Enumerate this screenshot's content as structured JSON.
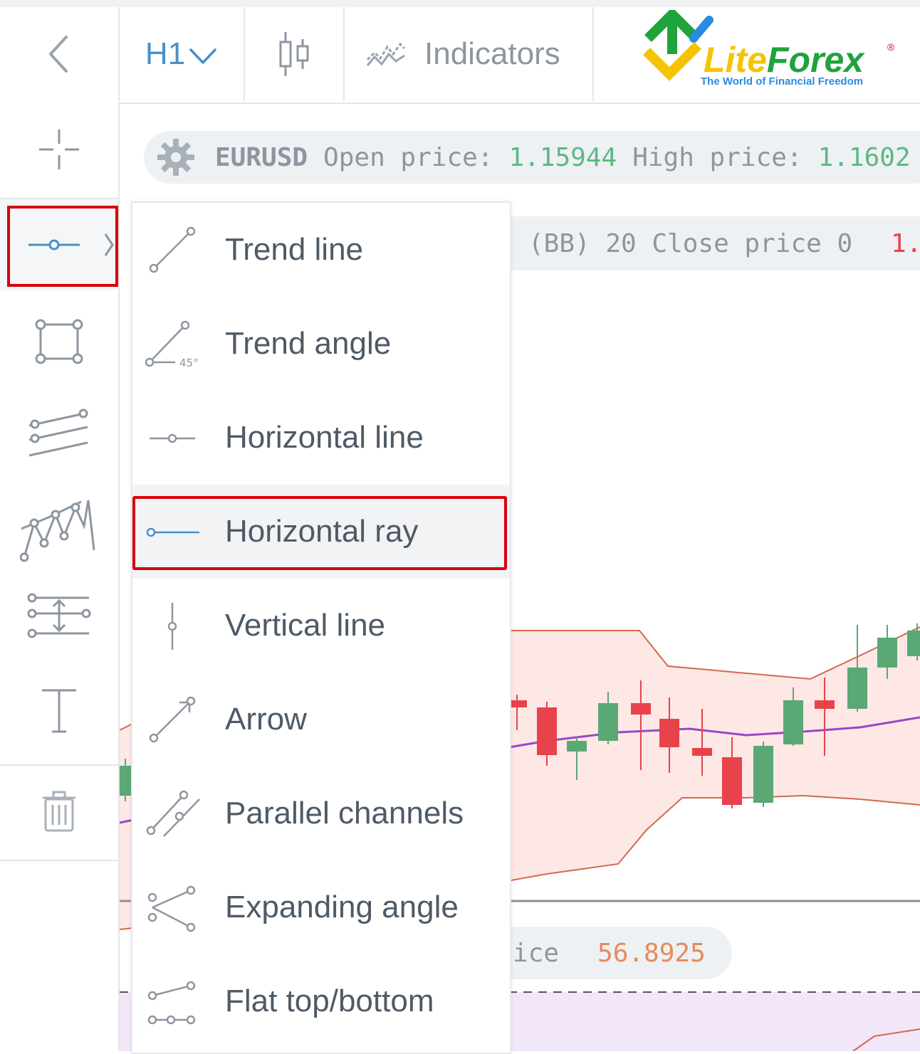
{
  "toolbar": {
    "back_icon": "chevron-left-icon",
    "timeframe": "H1",
    "chart_type_icon": "candlestick-icon",
    "indicators_label": "Indicators"
  },
  "logo": {
    "brand_part1": "Lite",
    "brand_part2": "Forex",
    "registered": "®",
    "tagline": "The World of Financial Freedom"
  },
  "info_bar": {
    "symbol": "EURUSD",
    "open_label": "Open price:",
    "open_value": "1.15944",
    "high_label": "High price:",
    "high_value": "1.1602"
  },
  "indicator_bar": {
    "text": "(BB) 20 Close price 0",
    "value": "1."
  },
  "oscillator_bar": {
    "text": "ice",
    "value": "56.8925"
  },
  "left_tools": [
    {
      "name": "crosshair-icon",
      "active": false
    },
    {
      "name": "horizontal-line-tool-icon",
      "active": true
    },
    {
      "name": "rectangle-icon",
      "active": false
    },
    {
      "name": "parallel-lines-icon",
      "active": false
    },
    {
      "name": "pattern-icon",
      "active": false
    },
    {
      "name": "fibonacci-icon",
      "active": false
    },
    {
      "name": "text-icon",
      "active": false
    },
    {
      "name": "trash-icon",
      "active": false
    }
  ],
  "menu": {
    "items": [
      {
        "label": "Trend line",
        "icon": "trend-line-icon"
      },
      {
        "label": "Trend angle",
        "icon": "trend-angle-icon",
        "angle_text": "45°"
      },
      {
        "label": "Horizontal line",
        "icon": "horizontal-line-icon"
      },
      {
        "label": "Horizontal ray",
        "icon": "horizontal-ray-icon",
        "selected": true
      },
      {
        "label": "Vertical line",
        "icon": "vertical-line-icon"
      },
      {
        "label": "Arrow",
        "icon": "arrow-icon"
      },
      {
        "label": "Parallel channels",
        "icon": "parallel-channels-icon"
      },
      {
        "label": "Expanding angle",
        "icon": "expanding-angle-icon"
      },
      {
        "label": "Flat top/bottom",
        "icon": "flat-top-bottom-icon"
      }
    ]
  },
  "colors": {
    "accent": "#4a90c8",
    "highlight": "#d8000c",
    "bull": "#5aa874",
    "bear": "#e8424a",
    "band": "#d2694f",
    "ma": "#9b45c6",
    "band_fill": "#fde8e6"
  }
}
